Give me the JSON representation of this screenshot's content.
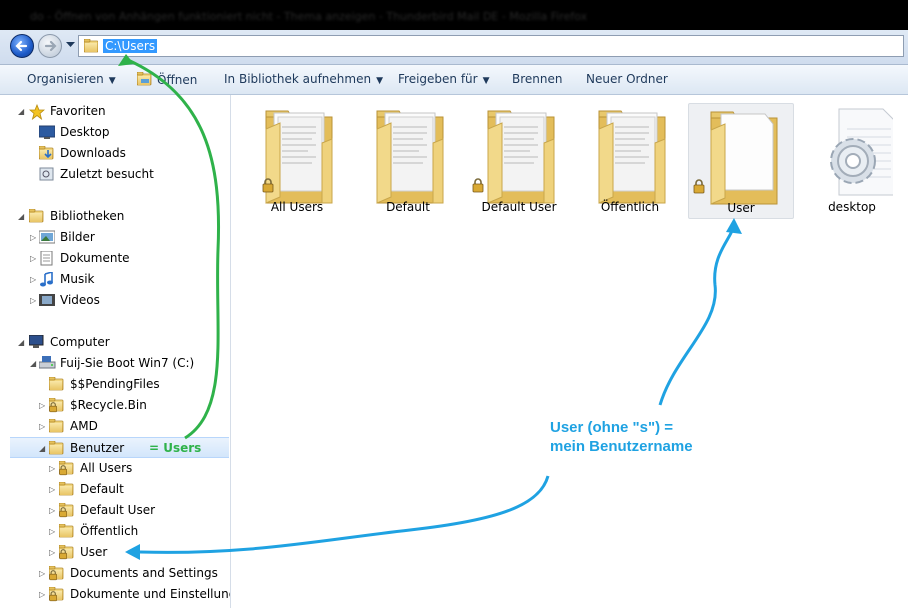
{
  "window": {
    "title": "do - Öffnen von Anhängen funktioniert nicht - Thema anzeigen - Thunderbird Mail DE - Mozilla Firefox"
  },
  "address": {
    "path": "C:\\Users"
  },
  "toolbar": {
    "organize": "Organisieren",
    "open": "Öffnen",
    "include_library": "In Bibliothek aufnehmen",
    "share": "Freigeben für",
    "burn": "Brennen",
    "new_folder": "Neuer Ordner"
  },
  "sidebar": {
    "favorites": "Favoriten",
    "desktop": "Desktop",
    "downloads": "Downloads",
    "recent": "Zuletzt besucht",
    "libraries": "Bibliotheken",
    "pictures": "Bilder",
    "documents": "Dokumente",
    "music": "Musik",
    "videos": "Videos",
    "computer": "Computer",
    "drive": "Fuij-Sie Boot Win7 (C:)",
    "pending": "$$PendingFiles",
    "recycle": "$Recycle.Bin",
    "amd": "AMD",
    "benutzer": "Benutzer",
    "all_users": "All Users",
    "default": "Default",
    "default_user": "Default User",
    "public": "Öffentlich",
    "user": "User",
    "docs_settings": "Documents and Settings",
    "docs_einst": "Dokumente und Einstellungen"
  },
  "files": [
    {
      "name": "All Users",
      "locked": true,
      "icon": "folder-icon"
    },
    {
      "name": "Default",
      "locked": false,
      "icon": "folder-icon"
    },
    {
      "name": "Default User",
      "locked": true,
      "icon": "folder-icon"
    },
    {
      "name": "Öffentlich",
      "locked": false,
      "icon": "folder-icon"
    },
    {
      "name": "User",
      "locked": true,
      "icon": "folder-icon"
    },
    {
      "name": "desktop",
      "locked": false,
      "icon": "settings-file-icon"
    }
  ],
  "annotations": {
    "users_note": "= Users",
    "user_note_line1": "User (ohne \"s\") =",
    "user_note_line2": "mein Benutzername"
  },
  "colors": {
    "green_annotation": "#2fb24a",
    "blue_annotation": "#1fa2e2",
    "selection": "#3399ff"
  }
}
